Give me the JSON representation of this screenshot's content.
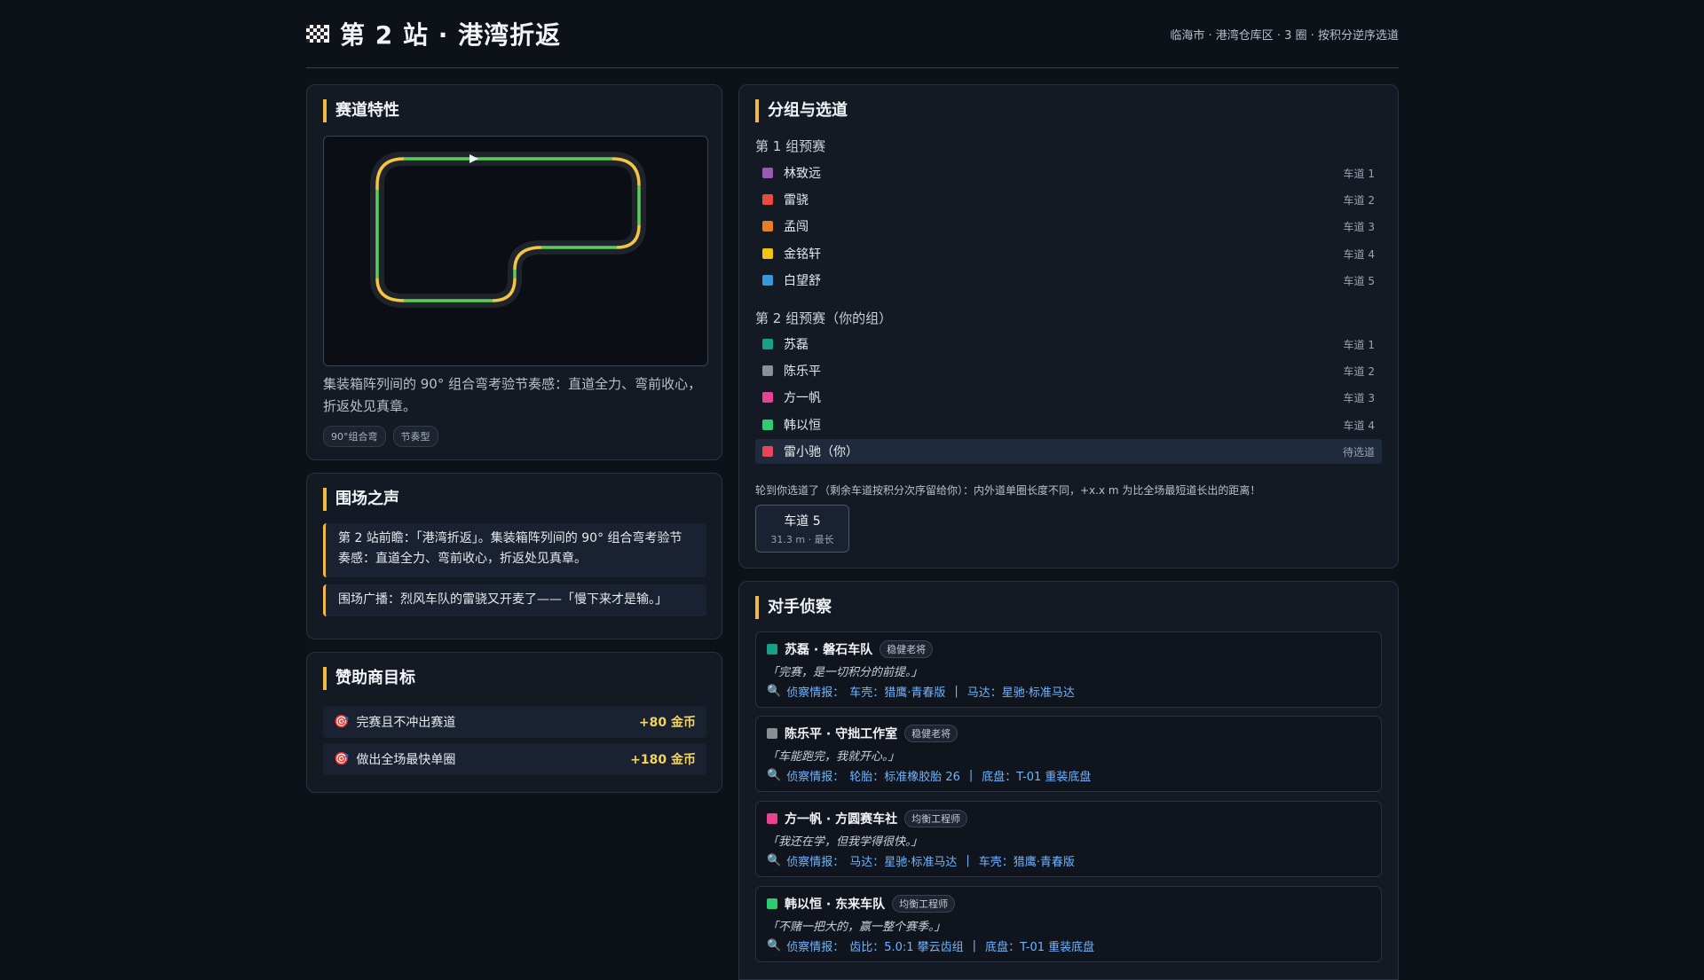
{
  "header": {
    "title": "第 2 站 · 港湾折返",
    "subtitle": "临海市 · 港湾仓库区 · 3 圈 · 按积分逆序选道"
  },
  "track": {
    "heading": "赛道特性",
    "description": "集装箱阵列间的 90° 组合弯考验节奏感：直道全力、弯前收心，折返处见真章。",
    "tags": [
      "90°组合弯",
      "节奏型"
    ]
  },
  "voice": {
    "heading": "围场之声",
    "quotes": [
      "第 2 站前瞻：「港湾折返」。集装箱阵列间的 90° 组合弯考验节奏感：直道全力、弯前收心，折返处见真章。",
      "围场广播：烈风车队的雷骁又开麦了——「慢下来才是输。」"
    ]
  },
  "sponsor": {
    "heading": "赞助商目标",
    "goals": [
      {
        "label": "完赛且不冲出赛道",
        "reward": "+80 金币"
      },
      {
        "label": "做出全场最快单圈",
        "reward": "+180 金币"
      }
    ]
  },
  "groups": {
    "heading": "分组与选道",
    "group1_label": "第 1 组预赛",
    "group1": [
      {
        "name": "林致远",
        "lane": "车道 1",
        "color": "#9b59b6"
      },
      {
        "name": "雷骁",
        "lane": "车道 2",
        "color": "#e74c3c"
      },
      {
        "name": "孟闯",
        "lane": "车道 3",
        "color": "#e67e22"
      },
      {
        "name": "金铭轩",
        "lane": "车道 4",
        "color": "#f1c40f"
      },
      {
        "name": "白望舒",
        "lane": "车道 5",
        "color": "#3498db"
      }
    ],
    "group2_label": "第 2 组预赛（你的组）",
    "group2": [
      {
        "name": "苏磊",
        "lane": "车道 1",
        "color": "#16a085"
      },
      {
        "name": "陈乐平",
        "lane": "车道 2",
        "color": "#8b9097"
      },
      {
        "name": "方一帆",
        "lane": "车道 3",
        "color": "#e84393"
      },
      {
        "name": "韩以恒",
        "lane": "车道 4",
        "color": "#2ecc71"
      },
      {
        "name": "雷小驰（你）",
        "lane": "待选道",
        "color": "#e8455a"
      }
    ],
    "note": "轮到你选道了（剩余车道按积分次序留给你）：内外道单圈长度不同，+x.x m 为比全场最短道长出的距离！",
    "option": {
      "title": "车道 5",
      "sub": "31.3 m · 最长"
    }
  },
  "scout": {
    "heading": "对手侦察",
    "opponents": [
      {
        "name": "苏磊 · 磐石车队",
        "badge": "稳健老将",
        "color": "#16a085",
        "quote": "「完赛，是一切积分的前提。」",
        "intel_label": "侦察情报：",
        "intel": [
          "车壳：猎鹰·青春版",
          "马达：星驰·标准马达"
        ]
      },
      {
        "name": "陈乐平 · 守拙工作室",
        "badge": "稳健老将",
        "color": "#8b9097",
        "quote": "「车能跑完，我就开心。」",
        "intel_label": "侦察情报：",
        "intel": [
          "轮胎：标准橡胶胎 26",
          "底盘：T-01 重装底盘"
        ]
      },
      {
        "name": "方一帆 · 方圆赛车社",
        "badge": "均衡工程师",
        "color": "#e84393",
        "quote": "「我还在学，但我学得很快。」",
        "intel_label": "侦察情报：",
        "intel": [
          "马达：星驰·标准马达",
          "车壳：猎鹰·青春版"
        ]
      },
      {
        "name": "韩以恒 · 东来车队",
        "badge": "均衡工程师",
        "color": "#2ecc71",
        "quote": "「不赌一把大的，赢一整个赛季。」",
        "intel_label": "侦察情报：",
        "intel": [
          "齿比：5.0:1 攀云齿组",
          "底盘：T-01 重装底盘"
        ]
      }
    ]
  },
  "colors": {
    "accent": "#f4b942",
    "track_green": "#5ccf5a",
    "track_yellow": "#f4c542",
    "intel": "#6fb5ff"
  }
}
